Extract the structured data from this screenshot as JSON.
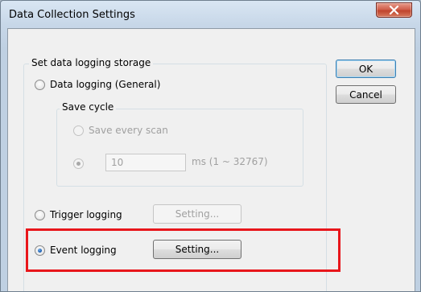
{
  "window": {
    "title": "Data Collection Settings"
  },
  "buttons": {
    "ok": "OK",
    "cancel": "Cancel"
  },
  "storage_group": {
    "legend": "Set data logging storage",
    "general": {
      "label": "Data logging (General)",
      "checked": false
    },
    "save_cycle": {
      "legend": "Save cycle",
      "every_scan_label": "Save every scan",
      "interval_value": "10",
      "interval_unit": "ms (1 ~ 32767)"
    },
    "trigger": {
      "label": "Trigger logging",
      "setting_label": "Setting...",
      "checked": false
    },
    "event": {
      "label": "Event logging",
      "setting_label": "Setting...",
      "checked": true
    }
  },
  "colors": {
    "highlight": "#e8161b",
    "title_close_button": "#c0442c"
  },
  "icons": {
    "close": "close-icon"
  }
}
